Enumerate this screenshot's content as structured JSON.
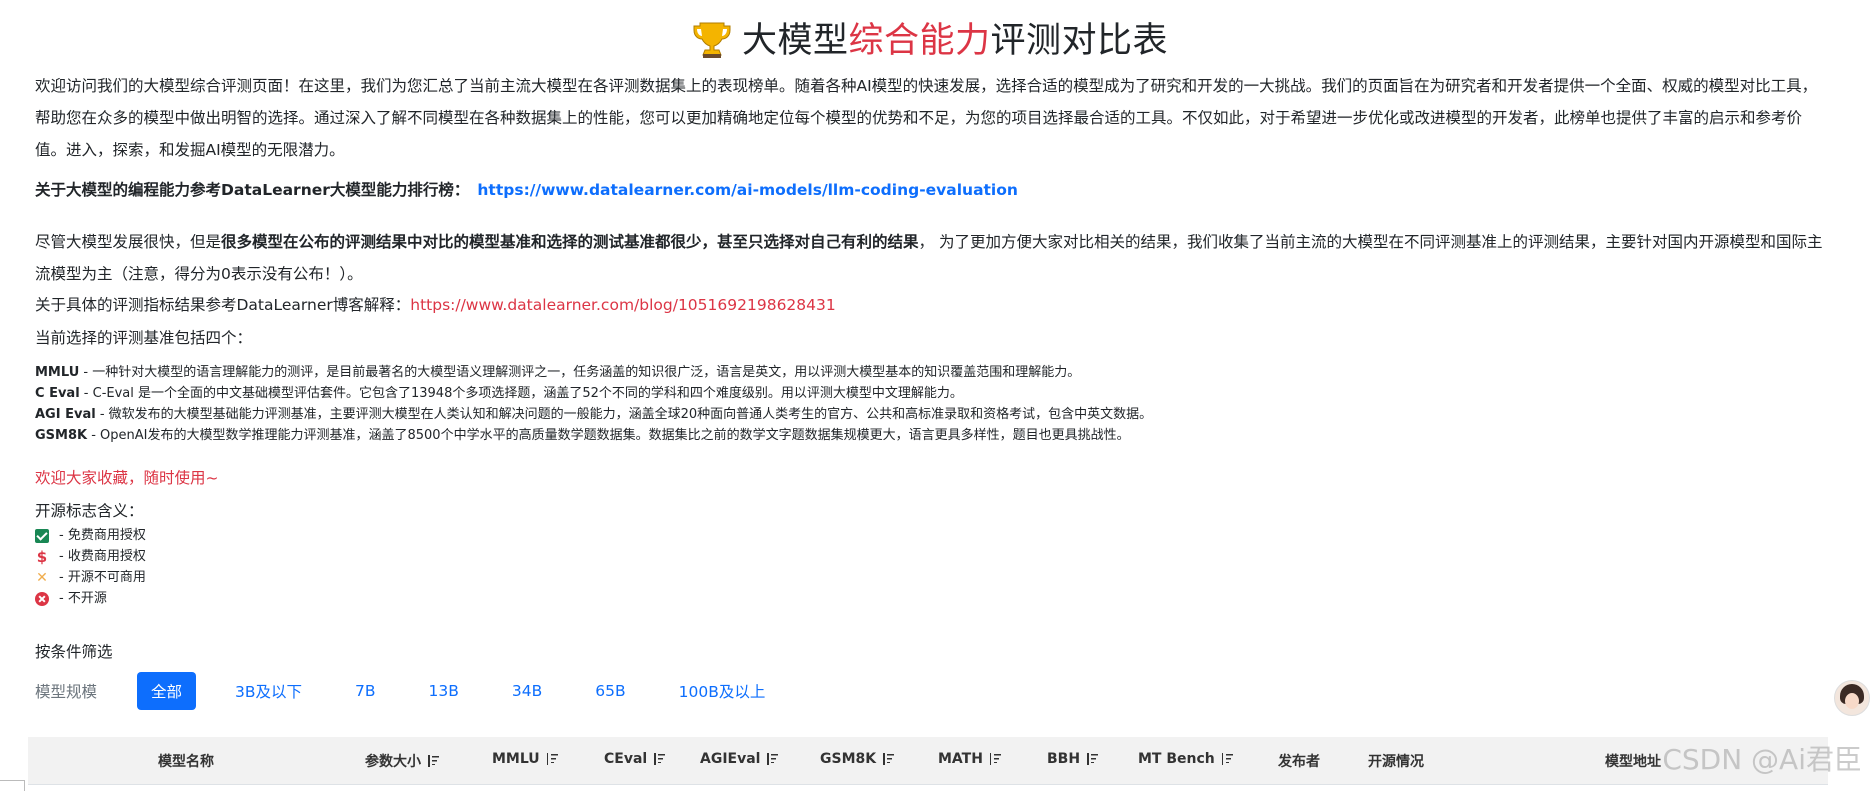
{
  "title": {
    "prefix": "大模型",
    "accent": "综合能力",
    "suffix": "评测对比表",
    "trophy_icon": "trophy-icon"
  },
  "intro": "欢迎访问我们的大模型综合评测页面！在这里，我们为您汇总了当前主流大模型在各评测数据集上的表现榜单。随着各种AI模型的快速发展，选择合适的模型成为了研究和开发的一大挑战。我们的页面旨在为研究者和开发者提供一个全面、权威的模型对比工具，帮助您在众多的模型中做出明智的选择。通过深入了解不同模型在各种数据集上的性能，您可以更加精确地定位每个模型的优势和不足，为您的项目选择最合适的工具。不仅如此，对于希望进一步优化或改进模型的开发者，此榜单也提供了丰富的启示和参考价值。进入，探索，和发掘AI模型的无限潜力。",
  "coding": {
    "label": "关于大模型的编程能力参考DataLearner大模型能力排行榜：",
    "link": "https://www.datalearner.com/ai-models/llm-coding-evaluation"
  },
  "notice": {
    "pre": "尽管大模型发展很快，但是",
    "bold": "很多模型在公布的评测结果中对比的模型基准和选择的测试基准都很少，甚至只选择对自己有利的结果",
    "post": "， 为了更加方便大家对比相关的结果，我们收集了当前主流的大模型在不同评测基准上的评测结果，主要针对国内开源模型和国际主流模型为主（注意，得分为0表示没有公布！）。"
  },
  "explain": {
    "label": "关于具体的评测指标结果参考DataLearner博客解释：",
    "link": "https://www.datalearner.com/blog/1051692198628431"
  },
  "current": "当前选择的评测基准包括四个：",
  "benchmarks": [
    {
      "name": "MMLU",
      "desc": " - 一种针对大模型的语言理解能力的测评，是目前最著名的大模型语义理解测评之一，任务涵盖的知识很广泛，语言是英文，用以评测大模型基本的知识覆盖范围和理解能力。"
    },
    {
      "name": "C Eval",
      "desc": " - C-Eval 是一个全面的中文基础模型评估套件。它包含了13948个多项选择题，涵盖了52个不同的学科和四个难度级别。用以评测大模型中文理解能力。"
    },
    {
      "name": "AGI Eval",
      "desc": " - 微软发布的大模型基础能力评测基准，主要评测大模型在人类认知和解决问题的一般能力，涵盖全球20种面向普通人类考生的官方、公共和高标准录取和资格考试，包含中英文数据。"
    },
    {
      "name": "GSM8K",
      "desc": " - OpenAI发布的大模型数学推理能力评测基准，涵盖了8500个中学水平的高质量数学题数据集。数据集比之前的数学文字题数据集规模更大，语言更具多样性，题目也更具挑战性。"
    }
  ],
  "welcome": "欢迎大家收藏，随时使用~",
  "legend": {
    "title": "开源标志含义：",
    "items": [
      {
        "icon": "check-square-icon",
        "label": " - 免费商用授权"
      },
      {
        "icon": "dollar-icon",
        "label": " - 收费商用授权"
      },
      {
        "icon": "cross-icon",
        "label": " - 开源不可商用"
      },
      {
        "icon": "x-circle-icon",
        "label": " - 不开源"
      }
    ]
  },
  "filter": {
    "title": "按条件筛选",
    "label": "模型规模",
    "options": [
      "全部",
      "3B及以下",
      "7B",
      "13B",
      "34B",
      "65B",
      "100B及以上"
    ],
    "selected": "全部"
  },
  "table": {
    "columns": [
      "模型名称",
      "参数大小",
      "MMLU",
      "CEval",
      "AGIEval",
      "GSM8K",
      "MATH",
      "BBH",
      "MT Bench",
      "发布者",
      "开源情况",
      "模型地址"
    ],
    "sortable": [
      false,
      true,
      true,
      true,
      true,
      true,
      true,
      true,
      true,
      false,
      false,
      false
    ]
  },
  "watermark": "CSDN @Ai君臣",
  "colors": {
    "accent": "#dc3545",
    "link": "#0d6efd",
    "success": "#198754",
    "warning": "#f0ad4e"
  }
}
